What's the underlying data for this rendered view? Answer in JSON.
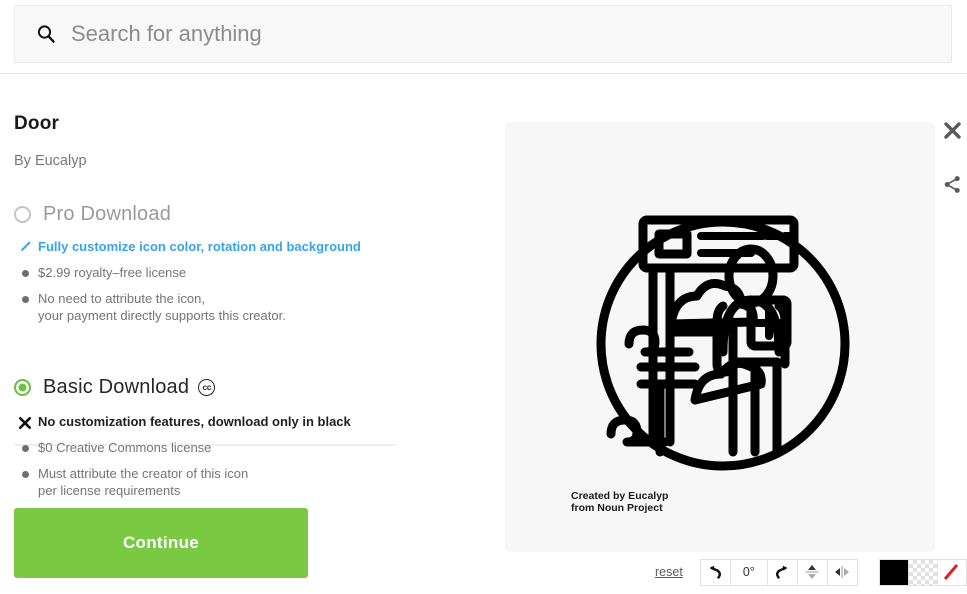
{
  "search": {
    "placeholder": "Search for anything",
    "value": "",
    "icon": "search-icon"
  },
  "icon_details": {
    "title": "Door",
    "author": "By Eucalyp"
  },
  "options": {
    "pro": {
      "label": "Pro Download",
      "selected": false,
      "features": [
        {
          "marker": "pencil-icon",
          "text": "Fully customize icon color, rotation and background",
          "style": "link"
        },
        {
          "marker": "bullet",
          "text": "$2.99 royalty–free license",
          "style": "normal"
        },
        {
          "marker": "bullet",
          "text": "No need to attribute the icon,\nyour payment directly supports this creator.",
          "style": "normal"
        }
      ]
    },
    "basic": {
      "label": "Basic Download",
      "badge": "cc",
      "selected": true,
      "features": [
        {
          "marker": "x-icon",
          "text": "No customization features, download only in black",
          "style": "strong"
        },
        {
          "marker": "bullet",
          "text": "$0 Creative Commons license",
          "style": "normal"
        },
        {
          "marker": "bullet",
          "text": "Must attribute the creator of this icon\nper license requirements",
          "style": "normal"
        }
      ]
    }
  },
  "continue_button": {
    "label": "Continue"
  },
  "preview": {
    "attribution_line1": "Created by Eucalyp",
    "attribution_line2": "from Noun Project"
  },
  "side_actions": [
    {
      "name": "close-icon",
      "label": "Close"
    },
    {
      "name": "share-icon",
      "label": "Share"
    }
  ],
  "toolbar": {
    "reset_label": "reset",
    "rotate_left_label": "↶",
    "rotation_value": "0°",
    "rotate_right_label": "↷",
    "flip_vertical_label": "flip-vertical",
    "flip_horizontal_label": "flip-horizontal",
    "swatches": [
      {
        "name": "black-swatch",
        "color": "#000000"
      },
      {
        "name": "transparent-swatch",
        "color": "transparent"
      },
      {
        "name": "no-color-swatch",
        "color": "#ffffff"
      }
    ]
  },
  "colors": {
    "accent_green": "#7ac943",
    "link_blue": "#3aa2e8",
    "panel_bg": "#f7f7f7",
    "search_bg": "#f8f8f8"
  }
}
